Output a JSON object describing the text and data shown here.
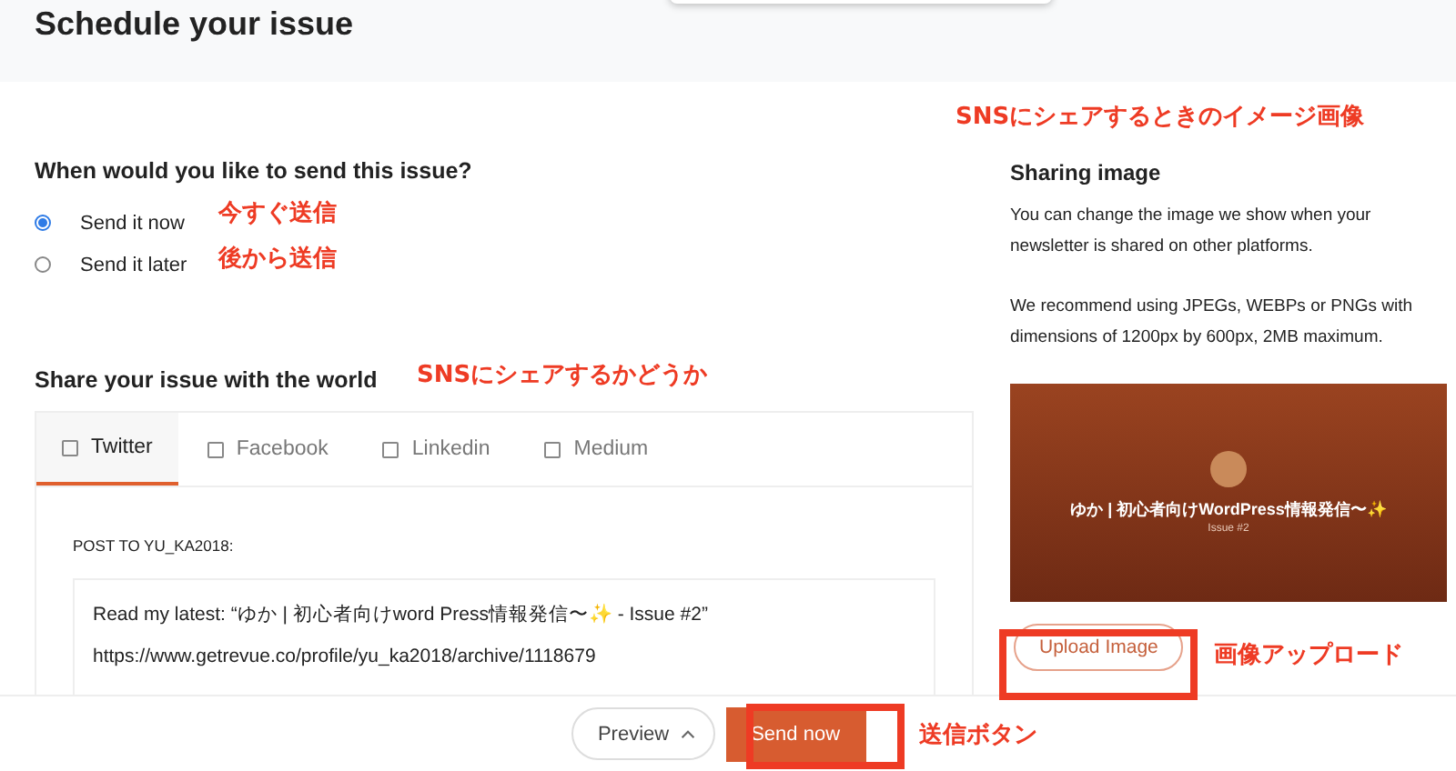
{
  "header": {
    "title": "Schedule your issue"
  },
  "schedule": {
    "question": "When would you like to send this issue?",
    "options": [
      {
        "label": "Send it now",
        "selected": true
      },
      {
        "label": "Send it later",
        "selected": false
      }
    ]
  },
  "share": {
    "heading": "Share your issue with the world",
    "tabs": [
      {
        "label": "Twitter",
        "selected": true,
        "checked": false
      },
      {
        "label": "Facebook",
        "selected": false,
        "checked": false
      },
      {
        "label": "Linkedin",
        "selected": false,
        "checked": false
      },
      {
        "label": "Medium",
        "selected": false,
        "checked": false
      }
    ],
    "post_label": "POST TO YU_KA2018:",
    "post_text": "Read my latest: “ゆか | 初心者向けword Press情報発信〜✨ - Issue #2”\nhttps://www.getrevue.co/profile/yu_ka2018/archive/1118679"
  },
  "sharing_image": {
    "heading": "Sharing image",
    "description": "You can change the image we show when your newsletter is shared on other platforms.",
    "recommendation": "We recommend using JPEGs, WEBPs or PNGs with dimensions of 1200px by 600px, 2MB maximum.",
    "preview_title": "ゆか | 初心者向けWordPress情報発信〜✨",
    "preview_subtitle": "Issue #2",
    "upload_button": "Upload Image"
  },
  "footer": {
    "preview_button": "Preview",
    "send_button": "Send now"
  },
  "annotations": [
    {
      "kind": "text",
      "text": "SNSにシェアするときのイメージ画像"
    },
    {
      "kind": "text",
      "text": "今すぐ送信"
    },
    {
      "kind": "text",
      "text": "後から送信"
    },
    {
      "kind": "text",
      "text": "SNSにシェアするかどうか"
    },
    {
      "kind": "framed",
      "text": "画像アップロード"
    },
    {
      "kind": "framed",
      "text": "送信ボタン"
    }
  ]
}
